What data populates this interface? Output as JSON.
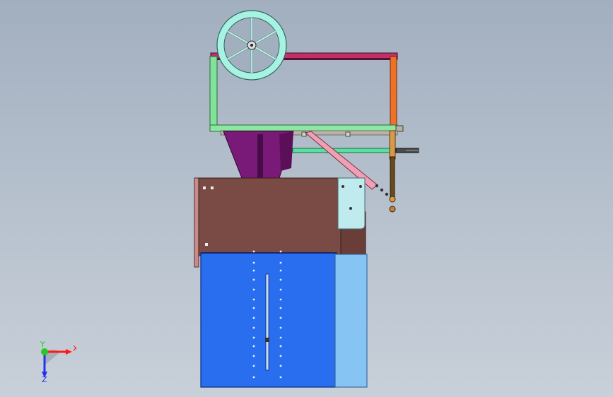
{
  "viewport": {
    "model": {
      "handwheel": {
        "spokes": 6
      }
    }
  },
  "triad": {
    "x_label": "X",
    "y_label": "Y",
    "z_label": "Z",
    "colors": {
      "x": "#ff1a1a",
      "y": "#22cc22",
      "z": "#2233ee"
    }
  }
}
